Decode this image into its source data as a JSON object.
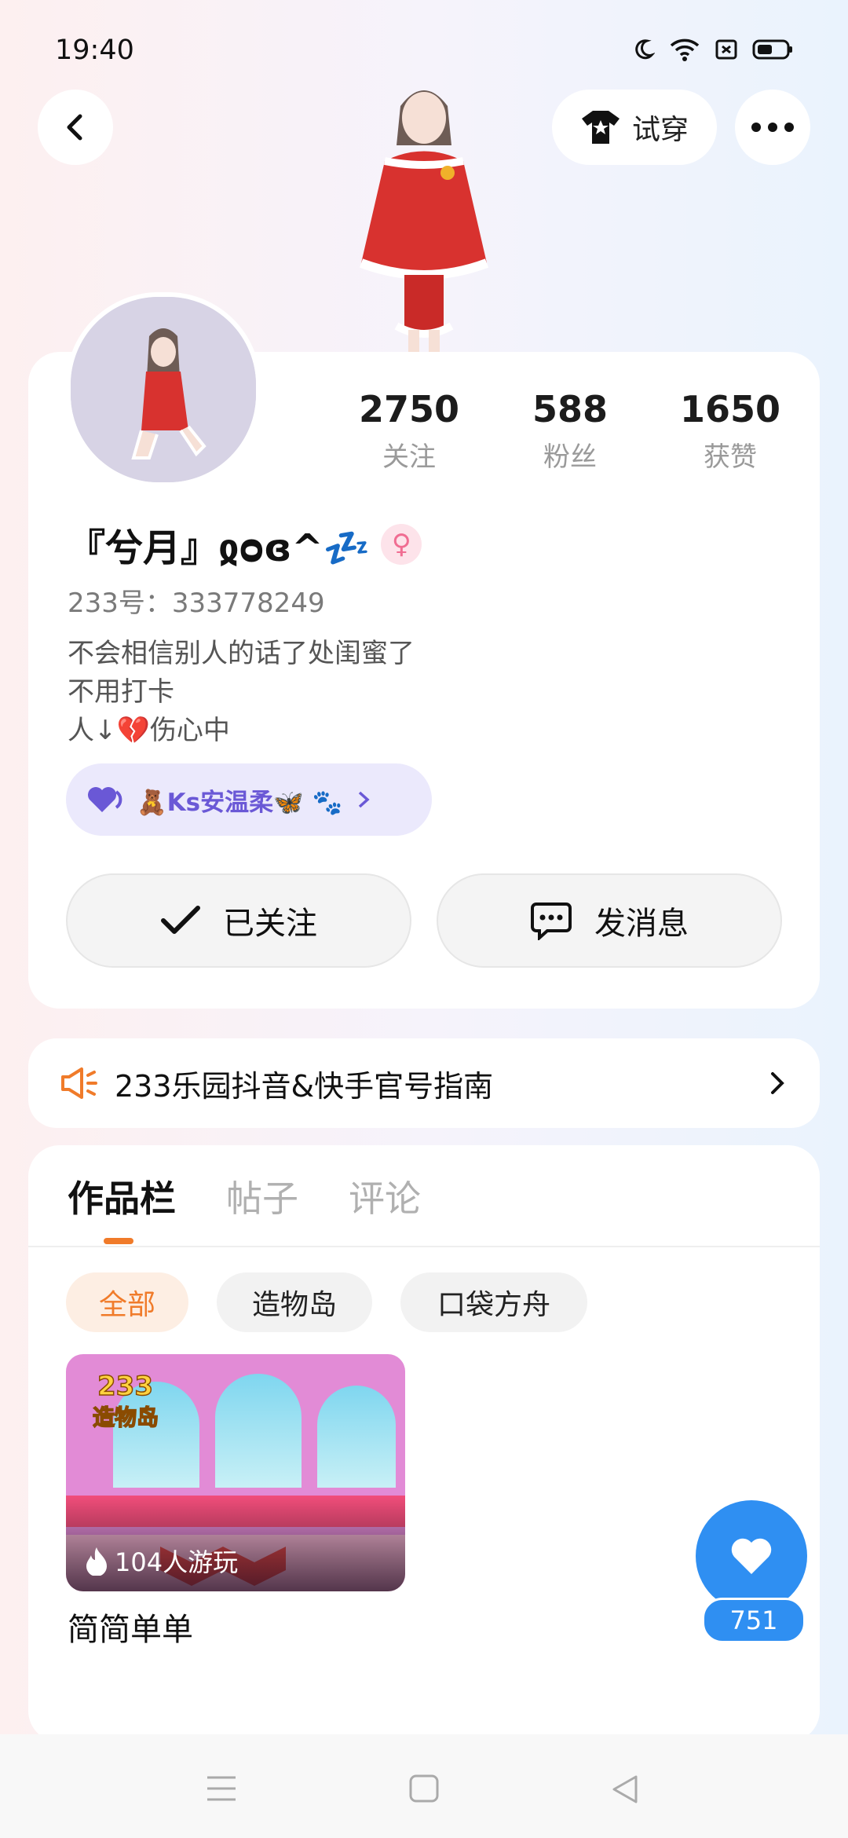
{
  "status_bar": {
    "time": "19:40"
  },
  "header": {
    "tryon_label": "试穿"
  },
  "profile": {
    "stats": [
      {
        "value": "2750",
        "label": "关注"
      },
      {
        "value": "588",
        "label": "粉丝"
      },
      {
        "value": "1650",
        "label": "获赞"
      }
    ],
    "nickname": "『兮月』ჲᴑɞ^💤",
    "id_text": "233号：333778249",
    "bio": [
      "不会相信别人的话了处闺蜜了",
      "不用打卡",
      "人↓💔伤心中"
    ],
    "fan_chip": "🧸Ks安温柔🦋 🐾",
    "follow_label": "已关注",
    "message_label": "发消息"
  },
  "notice": {
    "text": "233乐园抖音&快手官号指南"
  },
  "tabs": [
    {
      "label": "作品栏"
    },
    {
      "label": "帖子"
    },
    {
      "label": "评论"
    }
  ],
  "filters": [
    {
      "label": "全部"
    },
    {
      "label": "造物岛"
    },
    {
      "label": "口袋方舟"
    }
  ],
  "work": {
    "logo_top": "233",
    "logo_bottom": "造物岛",
    "plays": "104人游玩",
    "title": "简简单单"
  },
  "likes": {
    "count": "751"
  },
  "colors": {
    "accent": "#f07b2a",
    "like_blue": "#2f8ff2",
    "fan_purple": "#6a58d6"
  }
}
